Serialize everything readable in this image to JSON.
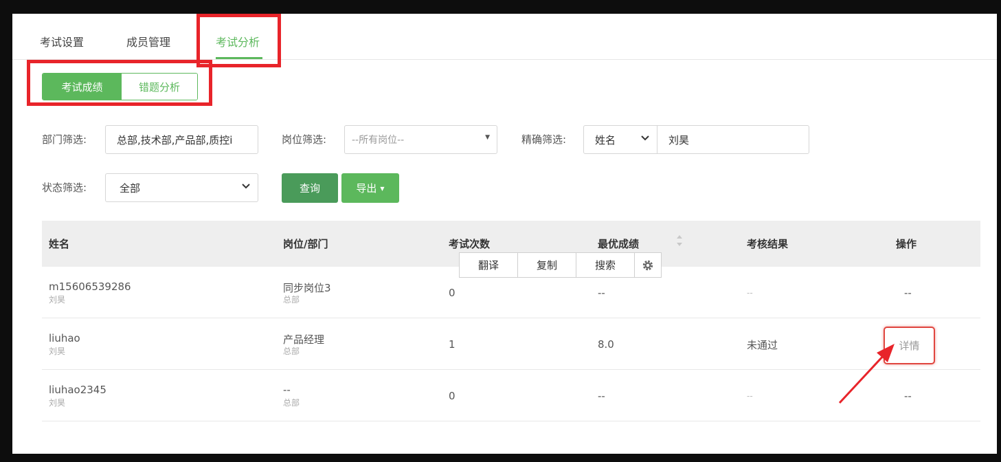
{
  "tabs": [
    {
      "label": "考试设置",
      "active": false
    },
    {
      "label": "成员管理",
      "active": false
    },
    {
      "label": "考试分析",
      "active": true
    }
  ],
  "subtabs": [
    {
      "label": "考试成绩",
      "active": true
    },
    {
      "label": "错题分析",
      "active": false
    }
  ],
  "filters": {
    "dept_label": "部门筛选:",
    "dept_value": "总部,技术部,产品部,质控i",
    "post_label": "岗位筛选:",
    "post_placeholder": "--所有岗位--",
    "exact_label": "精确筛选:",
    "exact_field": "姓名",
    "exact_value": "刘昊",
    "status_label": "状态筛选:",
    "status_value": "全部"
  },
  "buttons": {
    "query": "查询",
    "export": "导出"
  },
  "table": {
    "headers": [
      "姓名",
      "岗位/部门",
      "考试次数",
      "最优成绩",
      "考核结果",
      "操作"
    ],
    "rows": [
      {
        "name": "m15606539286",
        "nick": "刘昊",
        "post": "同步岗位3",
        "dept": "总部",
        "count": "0",
        "best": "--",
        "result": "--",
        "action": "--"
      },
      {
        "name": "liuhao",
        "nick": "刘昊",
        "post": "产品经理",
        "dept": "总部",
        "count": "1",
        "best": "8.0",
        "result": "未通过",
        "action": "详情"
      },
      {
        "name": "liuhao2345",
        "nick": "刘昊",
        "post": "--",
        "dept": "总部",
        "count": "0",
        "best": "--",
        "result": "--",
        "action": "--"
      }
    ]
  },
  "popup": {
    "translate": "翻译",
    "copy": "复制",
    "search": "搜索"
  },
  "colors": {
    "accent": "#5cb85c",
    "annotation": "#e8242a"
  }
}
